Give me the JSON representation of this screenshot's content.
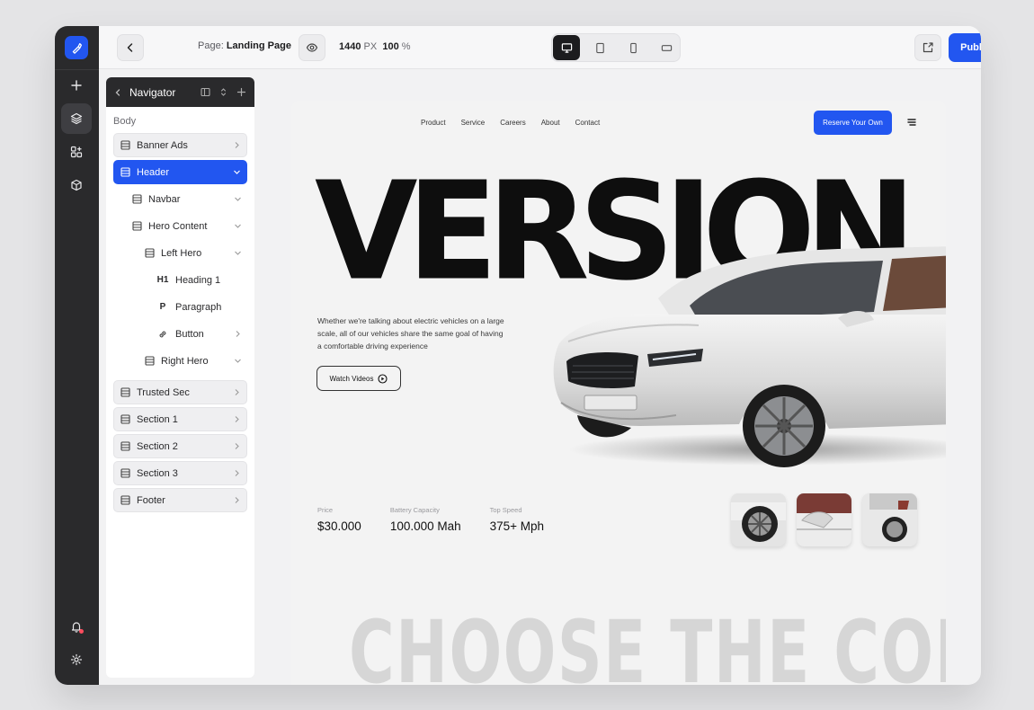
{
  "topbar": {
    "page_prefix": "Page:",
    "page_name": "Landing Page",
    "width_value": "1440",
    "width_unit": "PX",
    "zoom_value": "100",
    "zoom_unit": "%",
    "publish_label": "Publish",
    "active_device": "desktop"
  },
  "navigator": {
    "title": "Navigator",
    "body_label": "Body",
    "items": [
      {
        "label": "Banner Ads"
      },
      {
        "label": "Header"
      },
      {
        "label": "Navbar"
      },
      {
        "label": "Hero Content"
      },
      {
        "label": "Left Hero"
      },
      {
        "tag": "H1",
        "label": "Heading 1"
      },
      {
        "tag": "P",
        "label": "Paragraph"
      },
      {
        "label": "Button"
      },
      {
        "label": "Right Hero"
      },
      {
        "label": "Trusted Sec"
      },
      {
        "label": "Section 1"
      },
      {
        "label": "Section 2"
      },
      {
        "label": "Section 3"
      },
      {
        "label": "Footer"
      }
    ]
  },
  "site": {
    "nav": [
      "Product",
      "Service",
      "Careers",
      "About",
      "Contact"
    ],
    "cta": "Reserve Your Own",
    "hero_title": "VERSION",
    "hero_paragraph": "Whether we're talking about electric vehicles on a large scale, all of our vehicles share the same goal of having a comfortable driving experience",
    "watch_label": "Watch Videos",
    "stats": [
      {
        "label": "Price",
        "value": "$30.000"
      },
      {
        "label": "Battery Capacity",
        "value": "100.000 Mah"
      },
      {
        "label": "Top Speed",
        "value": "375+ Mph"
      }
    ],
    "section_heading": "CHOOSE THE COLOR"
  },
  "colors": {
    "accent": "#2256f0",
    "rail": "#2a2a2c",
    "canvas": "#f3f3f3"
  }
}
